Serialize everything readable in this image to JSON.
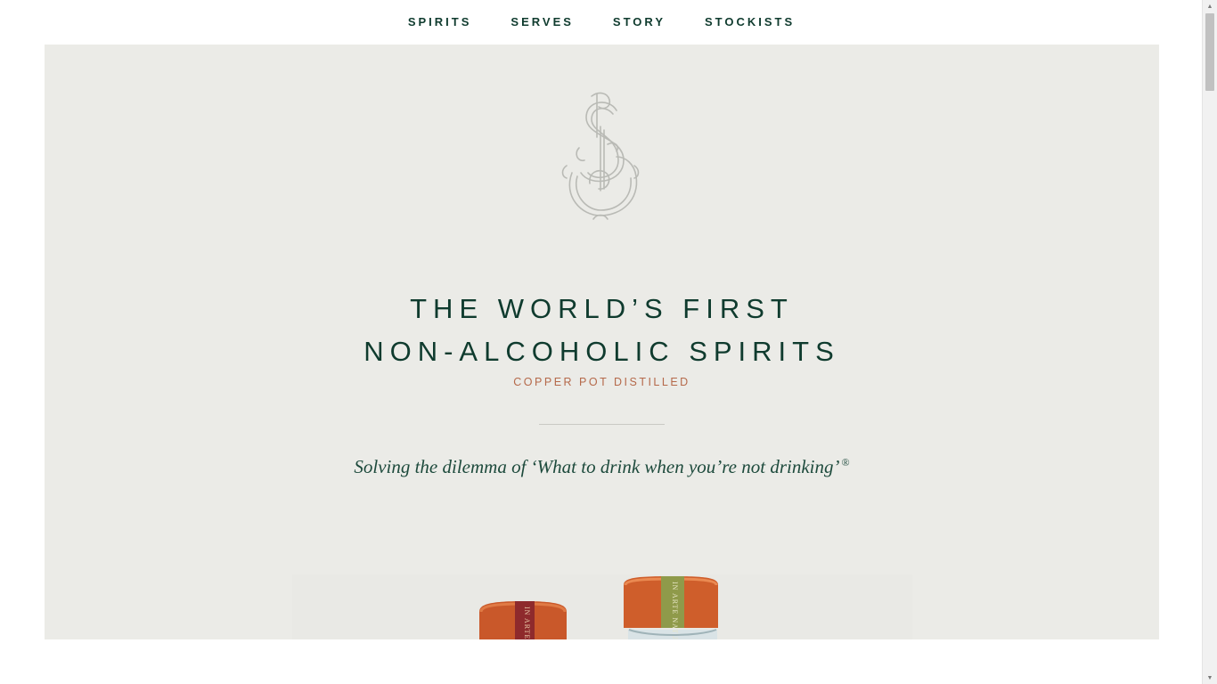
{
  "nav": {
    "items": [
      {
        "label": "SPIRITS"
      },
      {
        "label": "SERVES"
      },
      {
        "label": "STORY"
      },
      {
        "label": "STOCKISTS"
      }
    ]
  },
  "hero": {
    "logo_icon": "seedlip-monogram-icon",
    "headline_line1": "THE WORLD’S FIRST",
    "headline_line2": "NON-ALCOHOLIC SPIRITS",
    "tagline": "COPPER POT DISTILLED",
    "subtitle": "Solving the dilemma of ‘What to drink when you’re not drinking’",
    "subtitle_mark": "®",
    "bottle_left_label": "IN ARTE",
    "bottle_right_label": "IN ARTE NATURA"
  },
  "colors": {
    "brand_green": "#0f3b2e",
    "copper": "#b5694a",
    "hero_bg": "#ebebe7"
  }
}
